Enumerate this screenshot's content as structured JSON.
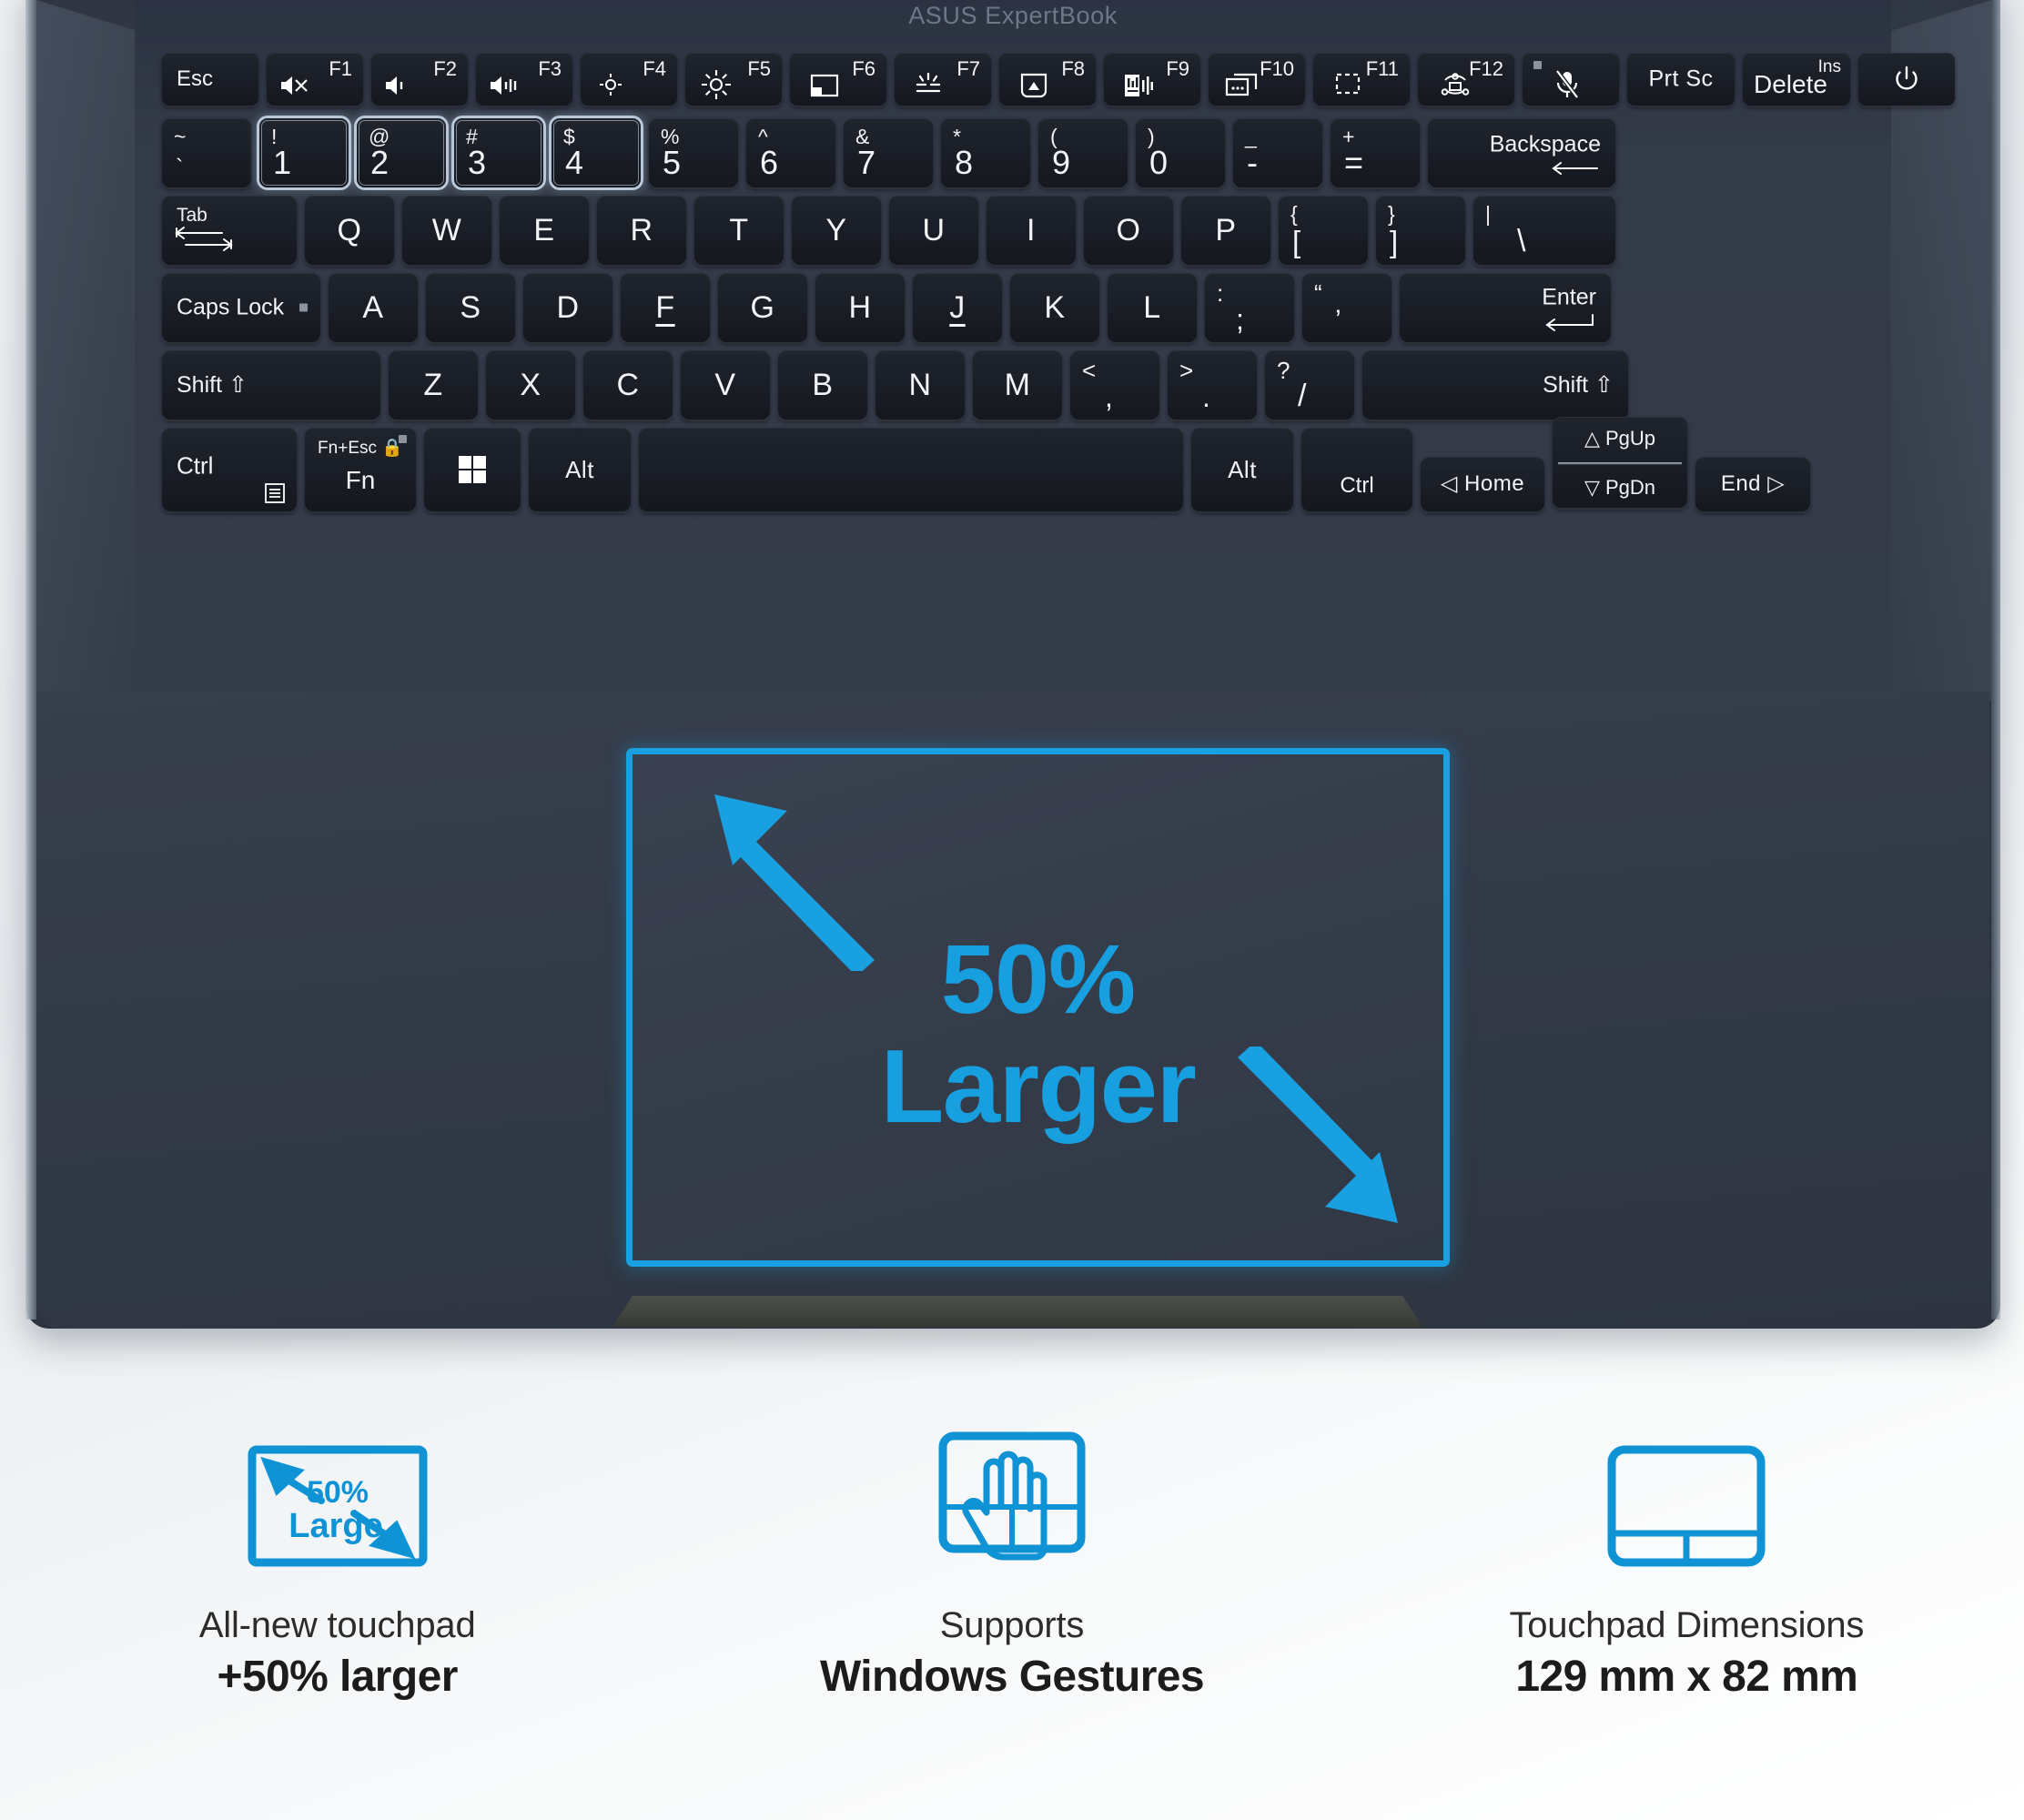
{
  "brand": "ASUS ExpertBook",
  "accent_color": "#18a0e0",
  "touchpad_overlay": {
    "line1": "50%",
    "line2": "Larger",
    "arrow_up_left": "arrow-up-left-icon",
    "arrow_down_right": "arrow-down-right-icon"
  },
  "keyboard": {
    "function_row": [
      {
        "label": "Esc",
        "fn": "",
        "icon": ""
      },
      {
        "label": "",
        "fn": "F1",
        "icon": "volume-mute-icon"
      },
      {
        "label": "",
        "fn": "F2",
        "icon": "volume-down-icon"
      },
      {
        "label": "",
        "fn": "F3",
        "icon": "volume-up-icon"
      },
      {
        "label": "",
        "fn": "F4",
        "icon": "brightness-down-icon"
      },
      {
        "label": "",
        "fn": "F5",
        "icon": "brightness-up-icon"
      },
      {
        "label": "",
        "fn": "F6",
        "icon": "touchpad-toggle-icon"
      },
      {
        "label": "",
        "fn": "F7",
        "icon": "keyboard-backlight-icon"
      },
      {
        "label": "",
        "fn": "F8",
        "icon": "display-switch-icon"
      },
      {
        "label": "",
        "fn": "F9",
        "icon": "noise-cancel-icon"
      },
      {
        "label": "",
        "fn": "F10",
        "icon": "window-switch-icon"
      },
      {
        "label": "",
        "fn": "F11",
        "icon": "screenshot-icon"
      },
      {
        "label": "",
        "fn": "F12",
        "icon": "myasus-icon"
      },
      {
        "label": "",
        "fn": "",
        "icon": "microphone-mute-icon"
      },
      {
        "label": "Prt Sc",
        "fn": "",
        "icon": ""
      },
      {
        "label": "Delete",
        "fn": "Ins",
        "icon": ""
      },
      {
        "label": "",
        "fn": "",
        "icon": "power-icon"
      }
    ],
    "row_numbers": [
      {
        "top": "~",
        "bottom": "`",
        "highlight": false
      },
      {
        "top": "!",
        "bottom": "1",
        "highlight": true
      },
      {
        "top": "@",
        "bottom": "2",
        "highlight": true
      },
      {
        "top": "#",
        "bottom": "3",
        "highlight": true
      },
      {
        "top": "$",
        "bottom": "4",
        "highlight": true
      },
      {
        "top": "%",
        "bottom": "5",
        "highlight": false
      },
      {
        "top": "^",
        "bottom": "6",
        "highlight": false
      },
      {
        "top": "&",
        "bottom": "7",
        "highlight": false
      },
      {
        "top": "*",
        "bottom": "8",
        "highlight": false
      },
      {
        "top": "(",
        "bottom": "9",
        "highlight": false
      },
      {
        "top": ")",
        "bottom": "0",
        "highlight": false
      },
      {
        "top": "_",
        "bottom": "-",
        "highlight": false
      },
      {
        "top": "+",
        "bottom": "=",
        "highlight": false
      }
    ],
    "backspace": "Backspace",
    "tab": "Tab",
    "row_qwerty": [
      "Q",
      "W",
      "E",
      "R",
      "T",
      "Y",
      "U",
      "I",
      "O",
      "P"
    ],
    "bracket_left": {
      "top": "{",
      "bottom": "["
    },
    "bracket_right": {
      "top": "}",
      "bottom": "]"
    },
    "backslash": {
      "top": "|",
      "bottom": "\\"
    },
    "caps_lock": "Caps Lock",
    "row_asdf": [
      "A",
      "S",
      "D",
      "F",
      "G",
      "H",
      "J",
      "K",
      "L"
    ],
    "semicolon": {
      "top": ":",
      "bottom": ";"
    },
    "quote": {
      "top": "“",
      "bottom": "’"
    },
    "enter": "Enter",
    "shift_left": "Shift",
    "row_zxcv": [
      "Z",
      "X",
      "C",
      "V",
      "B",
      "N",
      "M"
    ],
    "comma": {
      "top": "<",
      "bottom": ","
    },
    "period": {
      "top": ">",
      "bottom": "."
    },
    "slash": {
      "top": "?",
      "bottom": "/"
    },
    "shift_right": "Shift",
    "ctrl_left": "Ctrl",
    "fn_key": {
      "top": "Fn+Esc",
      "bottom": "Fn"
    },
    "windows_key": "windows-icon",
    "alt_left": "Alt",
    "space": "",
    "alt_right": "Alt",
    "ctrl_right": "Ctrl",
    "home": "Home",
    "pgup": "PgUp",
    "pgdn": "PgDn",
    "end": "End"
  },
  "features": [
    {
      "icon": "touchpad-50-larger-icon",
      "icon_text_line1": "50%",
      "icon_text_line2": "Large",
      "caption_top": "All-new touchpad",
      "caption_bottom": "+50% larger"
    },
    {
      "icon": "windows-gestures-icon",
      "caption_top": "Supports",
      "caption_bottom": "Windows Gestures"
    },
    {
      "icon": "touchpad-dimensions-icon",
      "caption_top": "Touchpad Dimensions",
      "caption_bottom": "129 mm x 82 mm"
    }
  ]
}
